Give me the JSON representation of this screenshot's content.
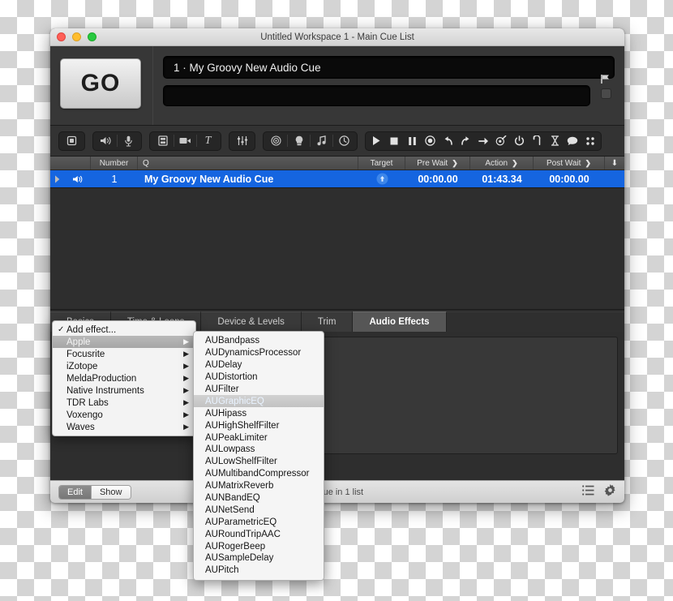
{
  "window": {
    "title": "Untitled Workspace 1 - Main Cue List",
    "traffic": {
      "close": "close-button",
      "minimize": "minimize-button",
      "zoom": "zoom-button"
    }
  },
  "header": {
    "go_label": "GO",
    "cue_display": "1 · My Groovy New Audio Cue",
    "secondary_display": "",
    "flag_icon": "flag-icon"
  },
  "toolbar": {
    "groups": [
      {
        "name": "group-new-cue",
        "buttons": [
          {
            "name": "new-cue-button",
            "icon": "copy-icon"
          }
        ]
      },
      {
        "name": "group-media",
        "buttons": [
          {
            "name": "new-audio-cue-button",
            "icon": "speaker-icon"
          },
          {
            "name": "new-mic-cue-button",
            "icon": "microphone-icon"
          }
        ]
      },
      {
        "name": "group-visual",
        "buttons": [
          {
            "name": "new-video-cue-button",
            "icon": "film-icon"
          },
          {
            "name": "new-camera-cue-button",
            "icon": "camera-icon"
          },
          {
            "name": "new-text-cue-button",
            "icon": "text-icon"
          }
        ]
      },
      {
        "name": "group-levels",
        "buttons": [
          {
            "name": "fade-cue-button",
            "icon": "sliders-icon"
          }
        ]
      },
      {
        "name": "group-control",
        "buttons": [
          {
            "name": "target-cue-button",
            "icon": "target-rings-icon"
          },
          {
            "name": "light-cue-button",
            "icon": "lightbulb-icon"
          },
          {
            "name": "midi-cue-button",
            "icon": "music-note-icon"
          },
          {
            "name": "wait-cue-button",
            "icon": "clock-icon"
          }
        ]
      },
      {
        "name": "group-transport",
        "buttons": [
          {
            "name": "play-button",
            "icon": "play-icon"
          },
          {
            "name": "stop-button",
            "icon": "stop-icon"
          },
          {
            "name": "pause-button",
            "icon": "pause-icon"
          },
          {
            "name": "record-button",
            "icon": "record-icon"
          },
          {
            "name": "undo-button",
            "icon": "undo-icon"
          },
          {
            "name": "redo-button",
            "icon": "redo-icon"
          },
          {
            "name": "goto-button",
            "icon": "arrow-right-icon"
          },
          {
            "name": "load-button",
            "icon": "target-arrow-icon"
          },
          {
            "name": "power-button",
            "icon": "power-icon"
          },
          {
            "name": "loop-button",
            "icon": "loop-icon"
          },
          {
            "name": "timer-button",
            "icon": "hourglass-icon"
          },
          {
            "name": "notes-button",
            "icon": "speech-bubble-icon"
          },
          {
            "name": "grid-button",
            "icon": "grid-icon"
          }
        ]
      }
    ]
  },
  "cuelist": {
    "columns": [
      {
        "label": "",
        "name": "col-status"
      },
      {
        "label": "Number",
        "name": "col-number"
      },
      {
        "label": "Q",
        "name": "col-q"
      },
      {
        "label": "Target",
        "name": "col-target"
      },
      {
        "label": "Pre Wait",
        "name": "col-pre-wait",
        "chevron": "❯"
      },
      {
        "label": "Action",
        "name": "col-action",
        "chevron": "❯"
      },
      {
        "label": "Post Wait",
        "name": "col-post-wait",
        "chevron": "❯"
      },
      {
        "label": "⬇",
        "name": "col-continue"
      }
    ],
    "rows": [
      {
        "icon": "speaker-icon",
        "number": "1",
        "name": "My Groovy New Audio Cue",
        "target": "target-disc-icon",
        "pre_wait": "00:00.00",
        "action": "01:43.34",
        "post_wait": "00:00.00",
        "selected": true
      }
    ]
  },
  "tabs": [
    {
      "label": "Basics",
      "name": "tab-basics",
      "active": false
    },
    {
      "label": "Time & Loops",
      "name": "tab-time-loops",
      "active": false
    },
    {
      "label": "Device & Levels",
      "name": "tab-device-levels",
      "active": false
    },
    {
      "label": "Trim",
      "name": "tab-trim",
      "active": false
    },
    {
      "label": "Audio Effects",
      "name": "tab-audio-effects",
      "active": true
    }
  ],
  "vendor_menu": {
    "items": [
      {
        "label": "Add effect...",
        "checked": true,
        "submenu": false,
        "selected": false
      },
      {
        "label": "Apple",
        "checked": false,
        "submenu": true,
        "selected": true
      },
      {
        "label": "Focusrite",
        "checked": false,
        "submenu": true,
        "selected": false
      },
      {
        "label": "iZotope",
        "checked": false,
        "submenu": true,
        "selected": false
      },
      {
        "label": "MeldaProduction",
        "checked": false,
        "submenu": true,
        "selected": false
      },
      {
        "label": "Native Instruments",
        "checked": false,
        "submenu": true,
        "selected": false
      },
      {
        "label": "TDR Labs",
        "checked": false,
        "submenu": true,
        "selected": false
      },
      {
        "label": "Voxengo",
        "checked": false,
        "submenu": true,
        "selected": false
      },
      {
        "label": "Waves",
        "checked": false,
        "submenu": true,
        "selected": false
      }
    ],
    "check_glyph": "✓",
    "arrow_glyph": "▶"
  },
  "au_menu": {
    "items": [
      {
        "label": "AUBandpass",
        "selected": false
      },
      {
        "label": "AUDynamicsProcessor",
        "selected": false
      },
      {
        "label": "AUDelay",
        "selected": false
      },
      {
        "label": "AUDistortion",
        "selected": false
      },
      {
        "label": "AUFilter",
        "selected": false
      },
      {
        "label": "AUGraphicEQ",
        "selected": true
      },
      {
        "label": "AUHipass",
        "selected": false
      },
      {
        "label": "AUHighShelfFilter",
        "selected": false
      },
      {
        "label": "AUPeakLimiter",
        "selected": false
      },
      {
        "label": "AULowpass",
        "selected": false
      },
      {
        "label": "AULowShelfFilter",
        "selected": false
      },
      {
        "label": "AUMultibandCompressor",
        "selected": false
      },
      {
        "label": "AUMatrixReverb",
        "selected": false
      },
      {
        "label": "AUNBandEQ",
        "selected": false
      },
      {
        "label": "AUNetSend",
        "selected": false
      },
      {
        "label": "AUParametricEQ",
        "selected": false
      },
      {
        "label": "AURoundTripAAC",
        "selected": false
      },
      {
        "label": "AURogerBeep",
        "selected": false
      },
      {
        "label": "AUSampleDelay",
        "selected": false
      },
      {
        "label": "AUPitch",
        "selected": false
      }
    ]
  },
  "statusbar": {
    "edit_label": "Edit",
    "show_label": "Show",
    "status_text": "1 cue in 1 list",
    "list_icon": "list-icon",
    "gear_icon": "gear-icon"
  },
  "colors": {
    "selection_blue": "#1565e0",
    "window_chrome": "#2b2b2b",
    "toolbar": "#333333",
    "menu_bg": "#f3f3f3"
  }
}
